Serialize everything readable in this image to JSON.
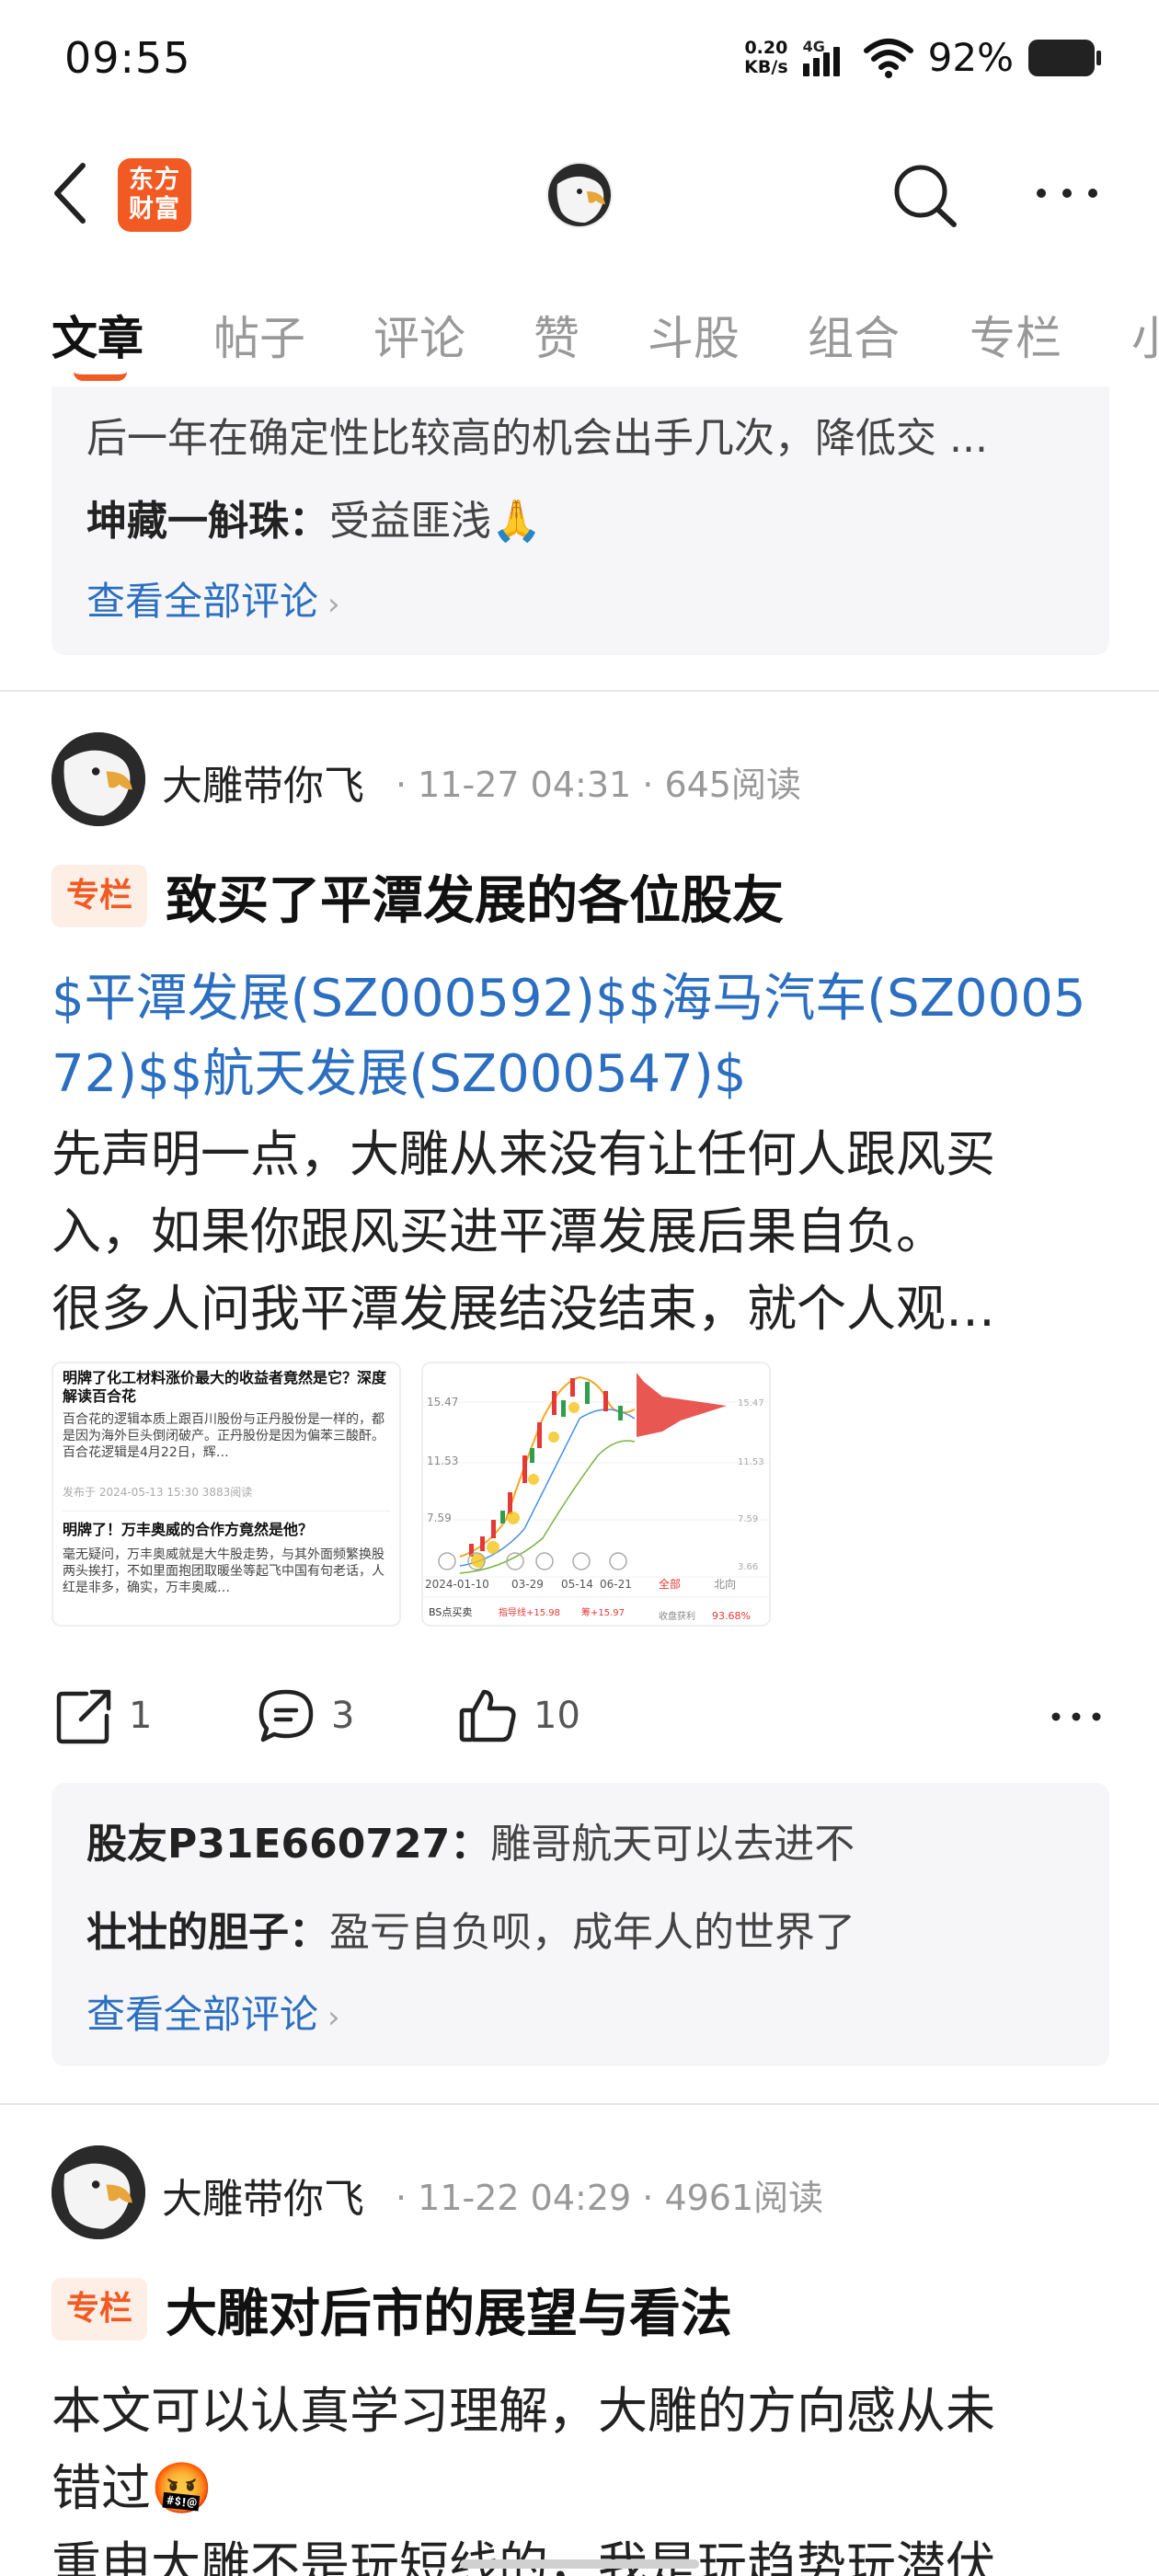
{
  "status_bar": {
    "time": "09:55",
    "net_speed_value": "0.20",
    "net_speed_unit": "KB/s",
    "network": "4G",
    "battery": "92%"
  },
  "nav": {
    "app_logo_line1": "东方",
    "app_logo_line2": "财富"
  },
  "tabs": [
    {
      "label": "文章",
      "active": true
    },
    {
      "label": "帖子"
    },
    {
      "label": "评论"
    },
    {
      "label": "赞"
    },
    {
      "label": "斗股"
    },
    {
      "label": "组合"
    },
    {
      "label": "专栏"
    },
    {
      "label": "小"
    }
  ],
  "top_comments": {
    "line0": "后一年在确定性比较高的机会出手几次，降低交 ...",
    "comments": [
      {
        "user": "坤藏一斛珠",
        "text": "受益匪浅🙏"
      }
    ],
    "view_all": "查看全部评论"
  },
  "posts": [
    {
      "author": "大雕带你飞",
      "date": "11-27 04:31",
      "reads": "645阅读",
      "tag": "专栏",
      "title": "致买了平潭发展的各位股友",
      "stock_line1": "$平潭发展(SZ000592)$$海马汽车(SZ0005",
      "stock_line2": "72)$$航天发展(SZ000547)$",
      "body": [
        "先声明一点，大雕从来没有让任何人跟风买",
        "入，如果你跟风买进平潭发展后果自负。",
        "很多人问我平潭发展结没结束，就个人观…"
      ],
      "thumb1": {
        "title1": "明牌了化工材料涨价最大的收益者竟然是它？深度解读百合花",
        "body1": "百合花的逻辑本质上跟百川股份与正丹股份是一样的，都是因为海外巨头倒闭破产。正丹股份是因为偏苯三酸酐。百合花逻辑是4月22日，辉…",
        "meta1": "发布于 2024-05-13 15:30 3883阅读",
        "title2": "明牌了！万丰奥威的合作方竟然是他？",
        "body2": "毫无疑问，万丰奥威就是大牛股走势，与其外面频繁换股两头挨打，不如里面抱团取暖坐等起飞中国有句老话，人红是非多，确实，万丰奥威…"
      },
      "thumb2": {
        "price_top": "15.47",
        "price_mid": "11.53",
        "price_low": "7.59",
        "price_bottom": "3.66",
        "date_start": "2024-01-10",
        "date_mid1": "03-29",
        "date_mid2": "05-14",
        "date_end": "06-21",
        "tab_all": "全部",
        "tab_north": "北向",
        "bs_label": "BS点买卖",
        "indicator1": "指导线+15.98",
        "indicator2": "筹+15.97",
        "profit_label": "收盘获利",
        "profit_value": "93.68%"
      },
      "shares": "1",
      "comments_count": "3",
      "likes": "10",
      "comments": [
        {
          "user": "股友P31E660727",
          "text": "雕哥航天可以去进不"
        },
        {
          "user": "壮壮的胆子",
          "text": "盈亏自负呗，成年人的世界了"
        }
      ],
      "view_all": "查看全部评论"
    },
    {
      "author": "大雕带你飞",
      "date": "11-22 04:29",
      "reads": "4961阅读",
      "tag": "专栏",
      "title": "大雕对后市的展望与看法",
      "body": [
        "本文可以认真学习理解，大雕的方向感从未",
        "错过🤬",
        "重申大雕不是玩短线的，我是玩趋势玩潜伏"
      ]
    }
  ],
  "colors": {
    "brand": "#f15a22",
    "link": "#2c6fc0",
    "tag_bg": "#fdeee6",
    "comment_bg": "#f6f6f8"
  }
}
